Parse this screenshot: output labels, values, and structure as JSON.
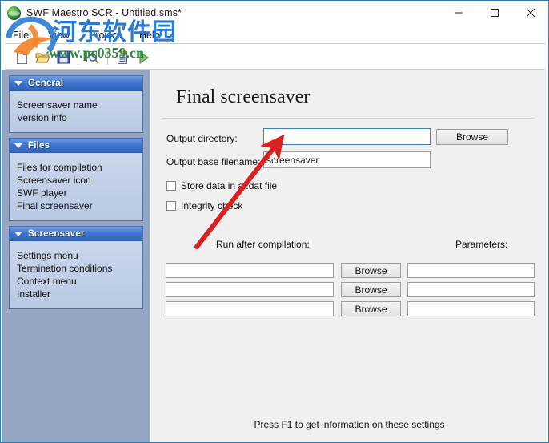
{
  "window": {
    "title": "SWF Maestro SCR - Untitled.sms*",
    "app_icon": "globe-icon",
    "minimize_label": "Minimize",
    "maximize_label": "Maximize",
    "close_label": "Close",
    "border_color": "#2f7ab0"
  },
  "menubar": {
    "items": [
      {
        "label": "File"
      },
      {
        "label": "View"
      },
      {
        "label": "Project"
      },
      {
        "label": "Help"
      }
    ]
  },
  "toolbar": {
    "buttons": [
      {
        "name": "new-file-icon",
        "label": "New"
      },
      {
        "name": "open-folder-icon",
        "label": "Open"
      },
      {
        "name": "save-floppy-icon",
        "label": "Save"
      },
      {
        "name": "preview-magnifier-icon",
        "label": "Preview"
      },
      {
        "name": "compile-list-icon",
        "label": "Compile"
      },
      {
        "name": "run-play-icon",
        "label": "Run"
      }
    ]
  },
  "sidebar": {
    "background_color": "#95a5c4",
    "panels": [
      {
        "title": "General",
        "collapsed": false,
        "items": [
          {
            "label": "Screensaver name"
          },
          {
            "label": "Version info"
          }
        ]
      },
      {
        "title": "Files",
        "collapsed": false,
        "items": [
          {
            "label": "Files for compilation"
          },
          {
            "label": "Screensaver icon"
          },
          {
            "label": "SWF player"
          },
          {
            "label": "Final screensaver"
          }
        ]
      },
      {
        "title": "Screensaver",
        "collapsed": false,
        "items": [
          {
            "label": "Settings menu"
          },
          {
            "label": "Termination conditions"
          },
          {
            "label": "Context menu"
          },
          {
            "label": "Installer"
          }
        ]
      }
    ]
  },
  "content": {
    "page_title": "Final screensaver",
    "output_directory": {
      "label": "Output directory:",
      "value": "",
      "focused": true,
      "browse_label": "Browse"
    },
    "output_base_filename": {
      "label": "Output base filename:",
      "value": "screensaver"
    },
    "checkboxes": [
      {
        "label": "Store data in a .dat file",
        "checked": false
      },
      {
        "label": "Integrity check",
        "checked": false
      }
    ],
    "run_after_compilation": {
      "column_label": "Run after compilation:",
      "parameters_label": "Parameters:",
      "rows": [
        {
          "command": "",
          "browse_label": "Browse",
          "parameters": ""
        },
        {
          "command": "",
          "browse_label": "Browse",
          "parameters": ""
        },
        {
          "command": "",
          "browse_label": "Browse",
          "parameters": ""
        }
      ]
    },
    "hint": "Press F1 to get information on these settings"
  },
  "annotation": {
    "arrow_color": "#d92121",
    "arrow_from": "245,307",
    "arrow_to": "345,178"
  },
  "watermark": {
    "site_name": "河东软件园",
    "url": "www.pc0359.cn",
    "site_color": "#2b7ad1",
    "url_color": "#2e8b3d"
  }
}
